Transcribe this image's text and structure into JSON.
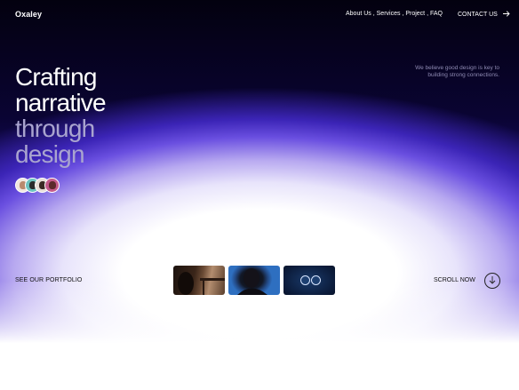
{
  "brand": {
    "name": "Oxaley"
  },
  "nav": {
    "items": [
      {
        "label": "About Us"
      },
      {
        "label": "Services"
      },
      {
        "label": "Project"
      },
      {
        "label": "FAQ"
      }
    ],
    "separator": " , ",
    "contact_label": "CONTACT US",
    "contact_icon": "arrow-right-icon"
  },
  "hero": {
    "line1": "Crafting",
    "line2": "narrative",
    "line3": "through",
    "line4": "design",
    "tagline": "We believe good design is key to building strong connections."
  },
  "avatars": [
    {
      "name": "avatar-1",
      "color": "#e9d7c9"
    },
    {
      "name": "avatar-2",
      "color": "#8fd3d0"
    },
    {
      "name": "avatar-3",
      "color": "#d7c9c0"
    },
    {
      "name": "avatar-4",
      "color": "#c45a8a"
    }
  ],
  "portfolio": {
    "label": "SEE OUR PORTFOLIO"
  },
  "thumbnails": [
    {
      "name": "thumbnail-interior"
    },
    {
      "name": "thumbnail-portrait"
    },
    {
      "name": "thumbnail-device"
    }
  ],
  "scroll": {
    "label": "SCROLL NOW",
    "icon": "arrow-down-icon"
  },
  "colors": {
    "accent": "#3b24b6",
    "dark": "#03010f",
    "muted_text": "#a9a4cf"
  }
}
